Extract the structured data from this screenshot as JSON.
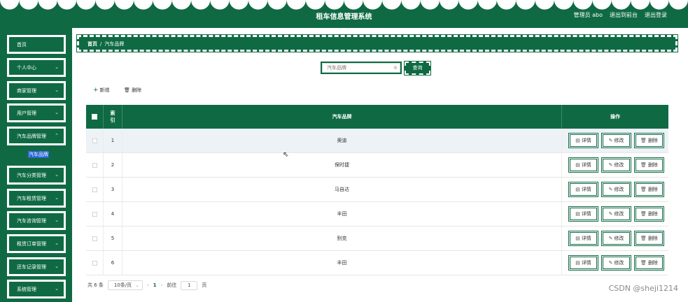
{
  "header": {
    "title": "租车信息管理系统",
    "admin_label": "管理员 abo",
    "back_front": "退出到前台",
    "logout": "退出登录"
  },
  "sidebar": {
    "items": [
      {
        "label": "首页"
      },
      {
        "label": "个人中心"
      },
      {
        "label": "商家管理"
      },
      {
        "label": "用户管理"
      },
      {
        "label": "汽车品牌管理"
      },
      {
        "label": "汽车分类管理"
      },
      {
        "label": "汽车租赁管理"
      },
      {
        "label": "汽车咨询管理"
      },
      {
        "label": "租赁订单管理"
      },
      {
        "label": "还车记录管理"
      },
      {
        "label": "系统管理"
      }
    ],
    "active_sub": "汽车品牌"
  },
  "breadcrumb": {
    "home": "首页",
    "separator": "/",
    "current": "汽车品牌"
  },
  "search": {
    "placeholder": "汽车品牌",
    "button": "查询"
  },
  "toolbar": {
    "add": "新增",
    "delete": "删除"
  },
  "table": {
    "columns": {
      "index": "索引",
      "brand": "汽车品牌",
      "actions": "操作"
    },
    "rows": [
      {
        "index": "1",
        "brand": "奥迪"
      },
      {
        "index": "2",
        "brand": "保时捷"
      },
      {
        "index": "3",
        "brand": "马自达"
      },
      {
        "index": "4",
        "brand": "丰田"
      },
      {
        "index": "5",
        "brand": "别克"
      },
      {
        "index": "6",
        "brand": "丰田"
      }
    ],
    "actions": {
      "detail": "详情",
      "edit": "修改",
      "delete": "删除"
    }
  },
  "pagination": {
    "total": "共 6 条",
    "page_size": "10条/页",
    "current_page": "1",
    "goto_label": "前往",
    "goto_value": "1",
    "page_unit": "页"
  },
  "watermark": "CSDN @sheji1214",
  "colors": {
    "primary": "#0f6a44",
    "accent_selected": "#2b66d6"
  }
}
